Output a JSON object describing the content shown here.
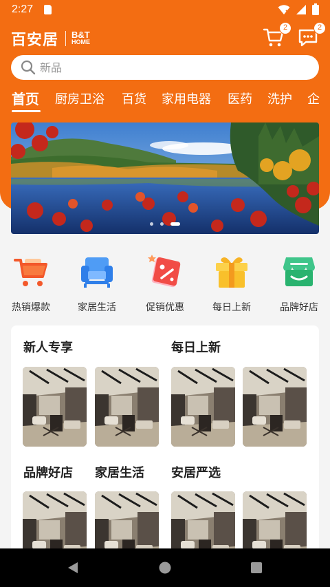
{
  "status_bar": {
    "time": "2:27"
  },
  "header": {
    "logo_cn": "百安居",
    "logo_en_line1": "B&T",
    "logo_en_line2": "HOME",
    "cart_badge": "2",
    "message_badge": "2"
  },
  "search": {
    "placeholder": "新品"
  },
  "tabs": [
    {
      "label": "首页"
    },
    {
      "label": "厨房卫浴"
    },
    {
      "label": "百货"
    },
    {
      "label": "家用电器"
    },
    {
      "label": "医药"
    },
    {
      "label": "洗护"
    },
    {
      "label": "企"
    }
  ],
  "banner": {
    "slides": 3,
    "active_index": 2
  },
  "quick_entries": [
    {
      "label": "热销爆款",
      "icon": "shopping-cart-icon"
    },
    {
      "label": "家居生活",
      "icon": "sofa-icon"
    },
    {
      "label": "促销优惠",
      "icon": "discount-tag-icon"
    },
    {
      "label": "每日上新",
      "icon": "gift-box-icon"
    },
    {
      "label": "品牌好店",
      "icon": "storefront-icon"
    }
  ],
  "sections": {
    "new_user": "新人专享",
    "daily_new": "每日上新",
    "brand_store": "品牌好店",
    "home_living": "家居生活",
    "selected": "安居严选"
  },
  "colors": {
    "brand_orange": "#f36d12",
    "background": "#f4f4f4"
  }
}
